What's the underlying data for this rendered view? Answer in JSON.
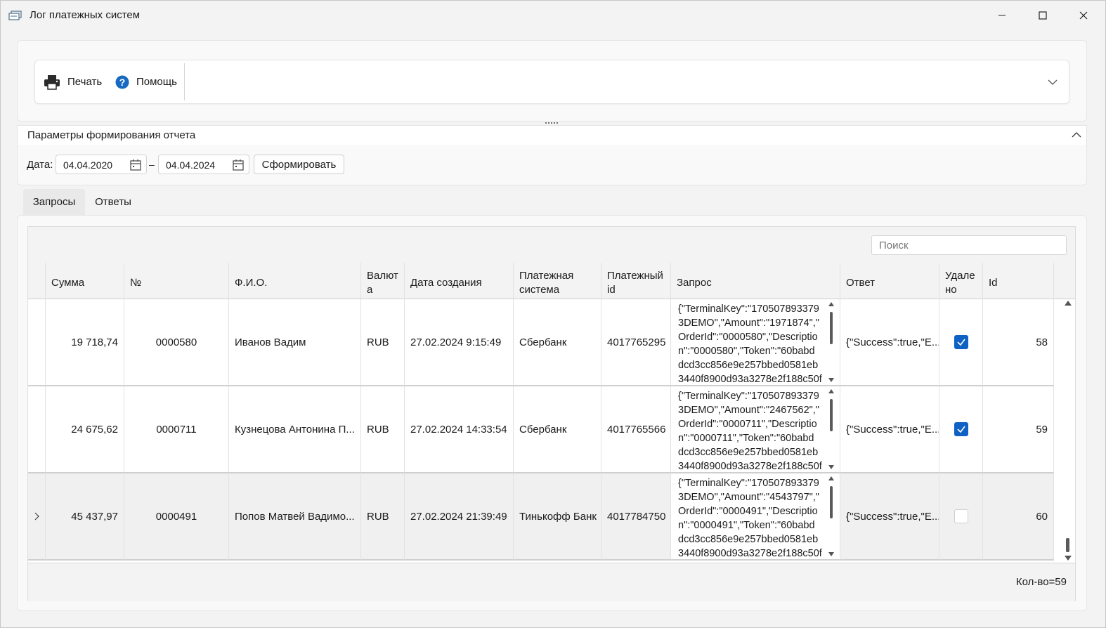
{
  "window": {
    "title": "Лог платежных систем"
  },
  "toolbar": {
    "print_label": "Печать",
    "help_label": "Помощь"
  },
  "params": {
    "title": "Параметры формирования отчета",
    "date_label": "Дата:",
    "date_from": "04.04.2020",
    "date_to": "04.04.2024",
    "separator": "–",
    "generate_label": "Сформировать"
  },
  "tabs": [
    {
      "label": "Запросы",
      "active": true
    },
    {
      "label": "Ответы",
      "active": false
    }
  ],
  "grid": {
    "search_placeholder": "Поиск",
    "columns": [
      "Сумма",
      "№",
      "Ф.И.О.",
      "Валют\nа",
      "Дата создания",
      "Платежная\nсистема",
      "Платежный\nid",
      "Запрос",
      "Ответ",
      "Удале\nно",
      "Id"
    ],
    "rows": [
      {
        "sum": "19 718,74",
        "num": "0000580",
        "fio": "Иванов Вадим",
        "currency": "RUB",
        "created": "27.02.2024 9:15:49",
        "system": "Сбербанк",
        "pay_id": "4017765295",
        "request": "{\"TerminalKey\":\"170507893379\n3DEMO\",\"Amount\":\"1971874\",\"\nOrderId\":\"0000580\",\"Descriptio\nn\":\"0000580\",\"Token\":\"60babd\ndcd3cc856e9e257bbed0581eb\n3440f8900d93a3278e2f188c50f",
        "response": "{\"Success\":true,\"E...",
        "deleted": true,
        "id": "58"
      },
      {
        "sum": "24 675,62",
        "num": "0000711",
        "fio": "Кузнецова Антонина П...",
        "currency": "RUB",
        "created": "27.02.2024 14:33:54",
        "system": "Сбербанк",
        "pay_id": "4017765566",
        "request": "{\"TerminalKey\":\"170507893379\n3DEMO\",\"Amount\":\"2467562\",\"\nOrderId\":\"0000711\",\"Descriptio\nn\":\"0000711\",\"Token\":\"60babd\ndcd3cc856e9e257bbed0581eb\n3440f8900d93a3278e2f188c50f",
        "response": "{\"Success\":true,\"E...",
        "deleted": true,
        "id": "59"
      },
      {
        "sum": "45 437,97",
        "num": "0000491",
        "fio": "Попов Матвей Вадимо...",
        "currency": "RUB",
        "created": "27.02.2024 21:39:49",
        "system": "Тинькофф Банк",
        "pay_id": "4017784750",
        "request": "{\"TerminalKey\":\"170507893379\n3DEMO\",\"Amount\":\"4543797\",\"\nOrderId\":\"0000491\",\"Descriptio\nn\":\"0000491\",\"Token\":\"60babd\ndcd3cc856e9e257bbed0581eb\n3440f8900d93a3278e2f188c50f",
        "response": "{\"Success\":true,\"E...",
        "deleted": false,
        "id": "60"
      }
    ],
    "footer_count": "Кол-во=59"
  },
  "colors": {
    "accent": "#0f62c4",
    "help_icon": "#1769c2"
  }
}
